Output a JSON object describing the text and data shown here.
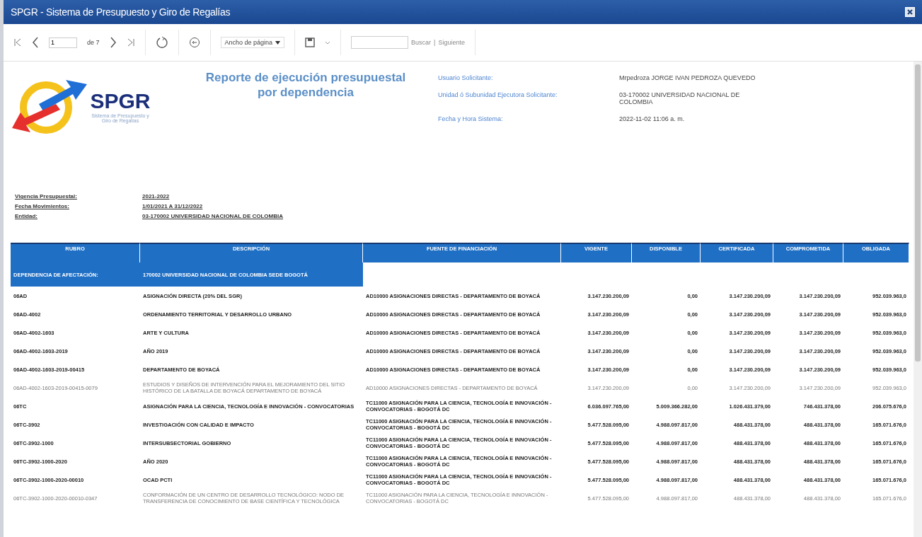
{
  "window": {
    "title": "SPGR - Sistema de Presupuesto y Giro de Regalías"
  },
  "toolbar": {
    "page": "1",
    "page_count": "de 7",
    "zoom": "Ancho de página",
    "find_links": [
      "Buscar",
      "|",
      "Siguiente"
    ]
  },
  "report": {
    "logo_text": "SPGR",
    "logo_subtitle": "Sistema de Presupuesto y Giro de Regalías",
    "title": "Reporte de ejecución presupuestal por dependencia",
    "info": [
      {
        "label": "Usuario Solicitante:",
        "value": "Mrpedroza JORGE IVAN PEDROZA QUEVEDO"
      },
      {
        "label": "Unidad ó Subunidad Ejecutora Solicitante:",
        "value": "03-170002 UNIVERSIDAD NACIONAL DE COLOMBIA"
      },
      {
        "label": "Fecha y Hora Sistema:",
        "value": "2022-11-02 11:06 a. m."
      }
    ],
    "params": [
      {
        "label": "Vigencia Presupuestal:",
        "value": "2021-2022"
      },
      {
        "label": "Fecha Movimientos:",
        "value": "1/01/2021 A 31/12/2022"
      },
      {
        "label": "Entidad:",
        "value": "03-170002 UNIVERSIDAD NACIONAL DE COLOMBIA"
      }
    ]
  },
  "table": {
    "columns": [
      "RUBRO",
      "DESCRIPCIÓN",
      "FUENTE DE FINANCIACIÓN",
      "VIGENTE",
      "DISPONIBLE",
      "CERTIFICADA",
      "COMPROMETIDA",
      "OBLIGADA"
    ],
    "group": [
      "DEPENDENCIA DE AFECTACIÓN:",
      "170002 UNIVERSIDAD NACIONAL DE COLOMBIA SEDE BOGOTÁ"
    ],
    "rows": [
      {
        "kind": "group",
        "cells": [
          "06AD",
          "ASIGNACIÓN DIRECTA (20% DEL SGR)",
          "AD10000 ASIGNACIONES DIRECTAS - DEPARTAMENTO DE BOYACÁ",
          "3.147.230.200,09",
          "0,00",
          "3.147.230.200,09",
          "3.147.230.200,09",
          "952.039.963,0"
        ]
      },
      {
        "kind": "group",
        "cells": [
          "06AD-4002",
          "ORDENAMIENTO TERRITORIAL Y DESARROLLO URBANO",
          "AD10000 ASIGNACIONES DIRECTAS - DEPARTAMENTO DE BOYACÁ",
          "3.147.230.200,09",
          "0,00",
          "3.147.230.200,09",
          "3.147.230.200,09",
          "952.039.963,0"
        ]
      },
      {
        "kind": "group",
        "cells": [
          "06AD-4002-1603",
          "ARTE Y CULTURA",
          "AD10000 ASIGNACIONES DIRECTAS - DEPARTAMENTO DE BOYACÁ",
          "3.147.230.200,09",
          "0,00",
          "3.147.230.200,09",
          "3.147.230.200,09",
          "952.039.963,0"
        ]
      },
      {
        "kind": "group",
        "cells": [
          "06AD-4002-1603-2019",
          "AÑO 2019",
          "AD10000 ASIGNACIONES DIRECTAS - DEPARTAMENTO DE BOYACÁ",
          "3.147.230.200,09",
          "0,00",
          "3.147.230.200,09",
          "3.147.230.200,09",
          "952.039.963,0"
        ]
      },
      {
        "kind": "group",
        "cells": [
          "06AD-4002-1603-2019-00415",
          "DEPARTAMENTO DE BOYACÁ",
          "AD10000 ASIGNACIONES DIRECTAS - DEPARTAMENTO DE BOYACÁ",
          "3.147.230.200,09",
          "0,00",
          "3.147.230.200,09",
          "3.147.230.200,09",
          "952.039.963,0"
        ]
      },
      {
        "kind": "leaf",
        "cells": [
          "06AD-4002-1603-2019-00415-0079",
          "ESTUDIOS Y DISEÑOS DE INTERVENCIÓN PARA EL MEJORAMIENTO DEL SITIO HISTÓRICO DE LA BATALLA DE BOYACÁ DEPARTAMENTO DE BOYACÁ",
          "AD10000 ASIGNACIONES DIRECTAS - DEPARTAMENTO DE BOYACÁ",
          "3.147.230.200,09",
          "0,00",
          "3.147.230.200,09",
          "3.147.230.200,09",
          "952.039.963,0"
        ]
      },
      {
        "kind": "group",
        "cells": [
          "06TC",
          "ASIGNACIÓN PARA LA CIENCIA, TECNOLOGÍA E INNOVACIÓN - CONVOCATORIAS",
          "TC11000 ASIGNACIÓN PARA LA CIENCIA, TECNOLOGÍA E INNOVACIÓN - CONVOCATORIAS - BOGOTÁ DC",
          "6.036.097.765,00",
          "5.009.366.282,00",
          "1.026.431.379,00",
          "746.431.378,00",
          "206.075.676,0"
        ]
      },
      {
        "kind": "group",
        "cells": [
          "06TC-3902",
          "INVESTIGACIÓN CON CALIDAD E IMPACTO",
          "TC11000 ASIGNACIÓN PARA LA CIENCIA, TECNOLOGÍA E INNOVACIÓN - CONVOCATORIAS - BOGOTÁ DC",
          "5.477.528.095,00",
          "4.988.097.817,00",
          "488.431.378,00",
          "488.431.378,00",
          "165.071.676,0"
        ]
      },
      {
        "kind": "group",
        "cells": [
          "06TC-3902-1000",
          "INTERSUBSECTORIAL GOBIERNO",
          "TC11000 ASIGNACIÓN PARA LA CIENCIA, TECNOLOGÍA E INNOVACIÓN - CONVOCATORIAS - BOGOTÁ DC",
          "5.477.528.095,00",
          "4.988.097.817,00",
          "488.431.378,00",
          "488.431.378,00",
          "165.071.676,0"
        ]
      },
      {
        "kind": "group",
        "cells": [
          "06TC-3902-1000-2020",
          "AÑO 2020",
          "TC11000 ASIGNACIÓN PARA LA CIENCIA, TECNOLOGÍA E INNOVACIÓN - CONVOCATORIAS - BOGOTÁ DC",
          "5.477.528.095,00",
          "4.988.097.817,00",
          "488.431.378,00",
          "488.431.378,00",
          "165.071.676,0"
        ]
      },
      {
        "kind": "group",
        "cells": [
          "06TC-3902-1000-2020-00010",
          "OCAD PCTI",
          "TC11000 ASIGNACIÓN PARA LA CIENCIA, TECNOLOGÍA E INNOVACIÓN - CONVOCATORIAS - BOGOTÁ DC",
          "5.477.528.095,00",
          "4.988.097.817,00",
          "488.431.378,00",
          "488.431.378,00",
          "165.071.676,0"
        ]
      },
      {
        "kind": "leaf",
        "cells": [
          "06TC-3902-1000-2020-00010-0347",
          "CONFORMACIÓN DE UN CENTRO DE DESARROLLO TECNOLÓGICO: NODO DE TRANSFERENCIA DE CONOCIMIENTO DE BASE CIENTÍFICA Y TECNOLÓGICA",
          "TC11000 ASIGNACIÓN PARA LA CIENCIA, TECNOLOGÍA E INNOVACIÓN - CONVOCATORIAS - BOGOTÁ DC",
          "5.477.528.095,00",
          "4.988.097.817,00",
          "488.431.378,00",
          "488.431.378,00",
          "165.071.676,0"
        ]
      }
    ]
  }
}
